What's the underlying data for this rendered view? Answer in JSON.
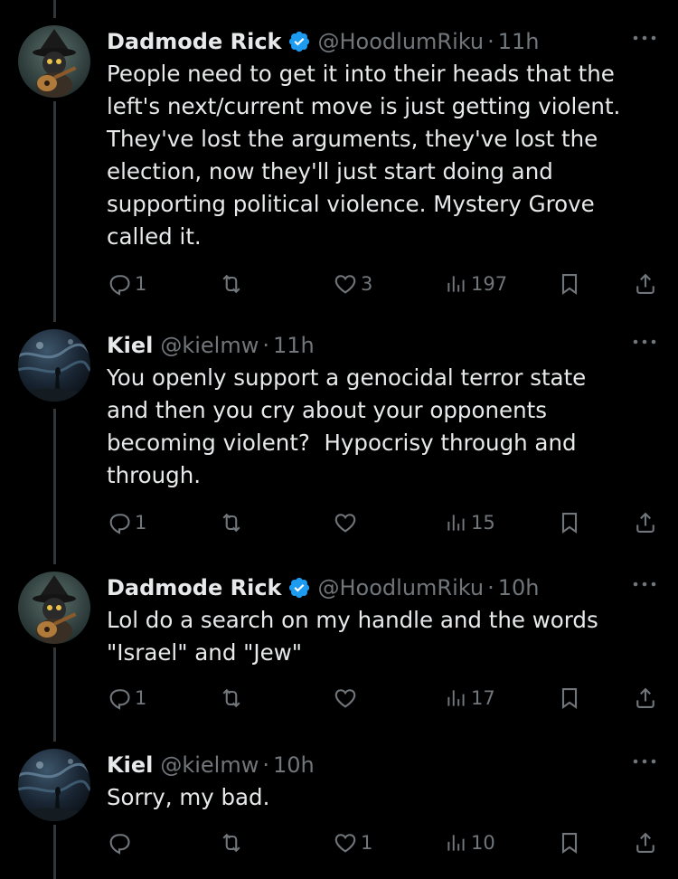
{
  "tweets": [
    {
      "name": "Dadmode Rick",
      "verified": true,
      "handle": "@HoodlumRiku",
      "separator": "·",
      "time": "11h",
      "text": "People need to get it into their heads that the\nleft's next/current move is just getting violent.\nThey've lost the arguments, they've lost the\nelection, now they'll just start doing and\nsupporting political violence. Mystery Grove\ncalled it.",
      "replies": "1",
      "reposts": "",
      "likes": "3",
      "views": "197"
    },
    {
      "name": "Kiel",
      "verified": false,
      "handle": "@kielmw",
      "separator": "·",
      "time": "11h",
      "text": "You openly support a genocidal terror state\nand then you cry about your opponents\nbecoming violent?  Hypocrisy through and\nthrough.",
      "replies": "1",
      "reposts": "",
      "likes": "",
      "views": "15"
    },
    {
      "name": "Dadmode Rick",
      "verified": true,
      "handle": "@HoodlumRiku",
      "separator": "·",
      "time": "10h",
      "text": "Lol do a search on my handle and the words\n\"Israel\" and \"Jew\"",
      "replies": "1",
      "reposts": "",
      "likes": "",
      "views": "17"
    },
    {
      "name": "Kiel",
      "verified": false,
      "handle": "@kielmw",
      "separator": "·",
      "time": "10h",
      "text": "Sorry, my bad.",
      "replies": "",
      "reposts": "",
      "likes": "1",
      "views": "10"
    }
  ],
  "colors": {
    "background": "#000000",
    "text": "#e7e9ea",
    "muted": "#71767b",
    "verified": "#1d9bf0",
    "thread_line": "#333639"
  },
  "icons": {
    "reply": "speech-bubble-icon",
    "repost": "repost-arrows-icon",
    "like": "heart-icon",
    "views": "bar-chart-icon",
    "bookmark": "bookmark-icon",
    "share": "share-upload-icon",
    "more": "three-dots-icon",
    "verified": "verified-badge-icon"
  }
}
